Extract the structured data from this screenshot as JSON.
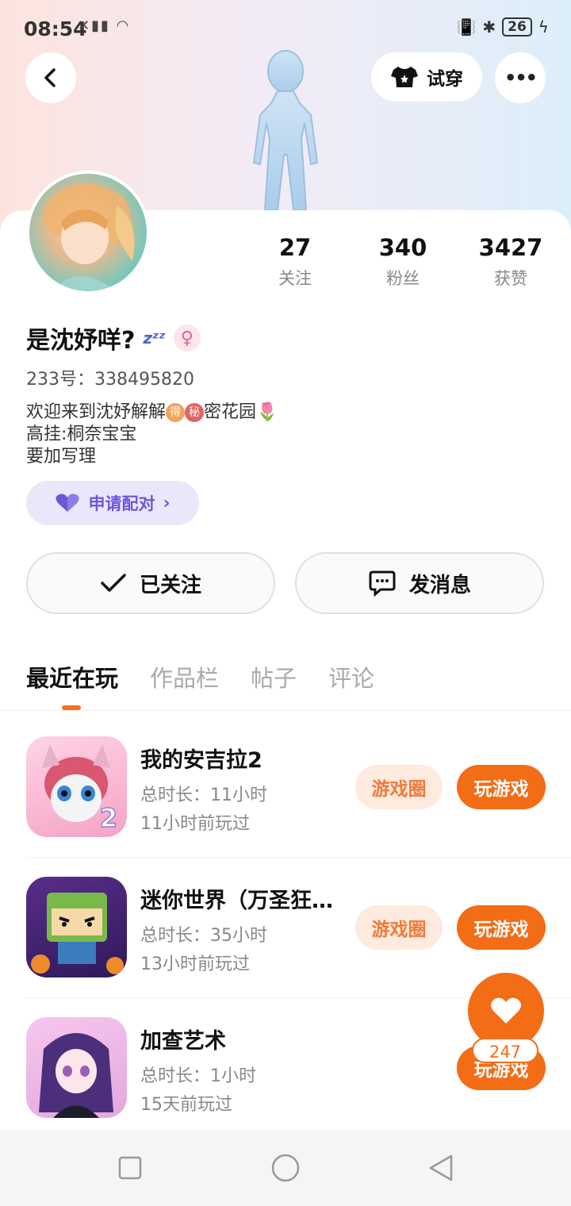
{
  "status": {
    "time": "08:54",
    "battery": "26"
  },
  "header": {
    "try_on_label": "试穿",
    "more_label": "•••"
  },
  "profile": {
    "name": "是沈妤咩?",
    "name_icon": "zzz-sleep-icon",
    "gender_symbol": "♀",
    "uid": "233号：338495820",
    "bio": {
      "line1_a": "欢迎来到沈妤解解",
      "emoji1": "得",
      "emoji2": "秘",
      "line1_b": "密花园",
      "line2": "高挂:桐奈宝宝",
      "line3": "要加写理"
    },
    "pair_label": "申请配对"
  },
  "stats": [
    {
      "value": "27",
      "label": "关注"
    },
    {
      "value": "340",
      "label": "粉丝"
    },
    {
      "value": "3427",
      "label": "获赞"
    }
  ],
  "actions": {
    "followed_label": "已关注",
    "message_label": "发消息"
  },
  "tabs": [
    "最近在玩",
    "作品栏",
    "帖子",
    "评论"
  ],
  "games": [
    {
      "title": "我的安吉拉2",
      "duration": "总时长：11小时",
      "last_played": "11小时前玩过",
      "circle": "游戏圈",
      "play": "玩游戏",
      "badge": "2"
    },
    {
      "title": "迷你世界（万圣狂欢）",
      "duration": "总时长：35小时",
      "last_played": "13小时前玩过",
      "circle": "游戏圈",
      "play": "玩游戏",
      "badge": ""
    },
    {
      "title": "加查艺术",
      "duration": "总时长：1小时",
      "last_played": "15天前玩过",
      "circle": "",
      "play": "玩游戏",
      "badge": ""
    }
  ],
  "like": {
    "count": "247"
  },
  "colors": {
    "accent": "#f36c16",
    "pair": "#6c57d6",
    "circle_bg": "#feeadf"
  }
}
